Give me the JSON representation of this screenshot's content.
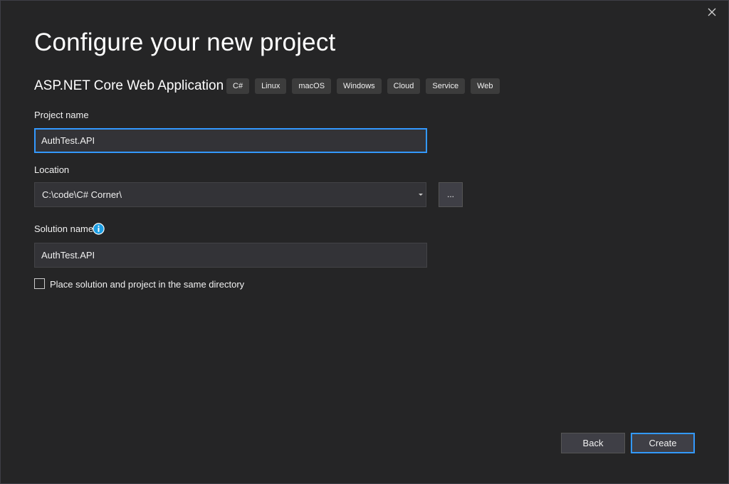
{
  "dialog": {
    "title": "Configure your new project",
    "template_name": "ASP.NET Core Web Application",
    "tags": [
      "C#",
      "Linux",
      "macOS",
      "Windows",
      "Cloud",
      "Service",
      "Web"
    ]
  },
  "project_name": {
    "label": "Project name",
    "value": "AuthTest.API"
  },
  "location": {
    "label": "Location",
    "value": "C:\\code\\C# Corner\\",
    "browse_label": "..."
  },
  "solution_name": {
    "label": "Solution name",
    "value": "AuthTest.API"
  },
  "same_directory": {
    "label": "Place solution and project in the same directory",
    "checked": false
  },
  "footer": {
    "back_label": "Back",
    "create_label": "Create"
  },
  "colors": {
    "background": "#252526",
    "accent": "#3399ff",
    "info_icon": "#1b9de2"
  },
  "icons": {
    "close": "close-icon",
    "info": "info-icon",
    "dropdown": "chevron-down-icon"
  }
}
